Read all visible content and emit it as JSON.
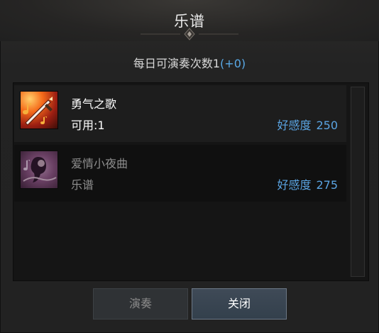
{
  "window": {
    "title": "乐谱",
    "subtitle_prefix": "每日可演奏次数1",
    "subtitle_bonus": "(+0)"
  },
  "songs": [
    {
      "name": "勇气之歌",
      "meta": "可用:1",
      "affinity_label": "好感度",
      "affinity_value": "250",
      "icon": "dagger-music-note-icon"
    },
    {
      "name": "爱情小夜曲",
      "meta": "乐谱",
      "affinity_label": "好感度",
      "affinity_value": "275",
      "icon": "serenade-figure-icon"
    }
  ],
  "buttons": {
    "play": "演奏",
    "close": "关闭"
  },
  "colors": {
    "accent_blue": "#5aa4e2",
    "bonus_blue": "#59a9e6",
    "panel_bg": "#151515"
  }
}
